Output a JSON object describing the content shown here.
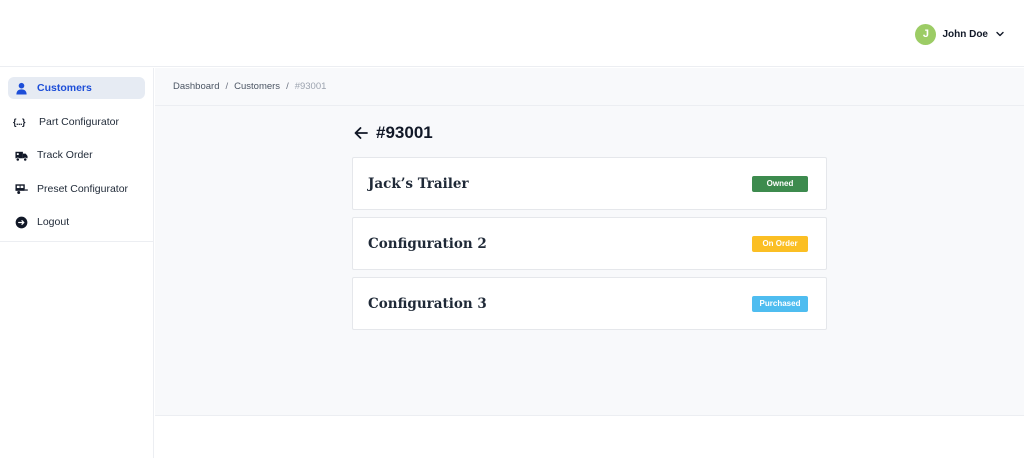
{
  "header": {
    "user": {
      "initial": "J",
      "name": "John Doe"
    }
  },
  "sidebar": {
    "items": [
      {
        "label": "Customers",
        "icon": "user-icon",
        "active": true
      },
      {
        "label": "Part Configurator",
        "icon": "braces-icon",
        "active": false
      },
      {
        "label": "Track Order",
        "icon": "truck-icon",
        "active": false
      },
      {
        "label": "Preset Configurator",
        "icon": "trailer-icon",
        "active": false
      },
      {
        "label": "Logout",
        "icon": "logout-icon",
        "active": false
      }
    ]
  },
  "breadcrumb": {
    "items": [
      "Dashboard",
      "Customers",
      "#93001"
    ],
    "separator": "/"
  },
  "page": {
    "title": "#93001"
  },
  "configurations": [
    {
      "name": "Jack’s Trailer",
      "status": "Owned",
      "status_color": "#3d8b4e"
    },
    {
      "name": "Configuration 2",
      "status": "On Order",
      "status_color": "#fbbf24"
    },
    {
      "name": "Configuration 3",
      "status": "Purchased",
      "status_color": "#4fbdf0"
    }
  ],
  "colors": {
    "accent": "#1d4ed8",
    "avatar": "#9ccc65",
    "active_nav_bg": "#e6ebf3"
  }
}
